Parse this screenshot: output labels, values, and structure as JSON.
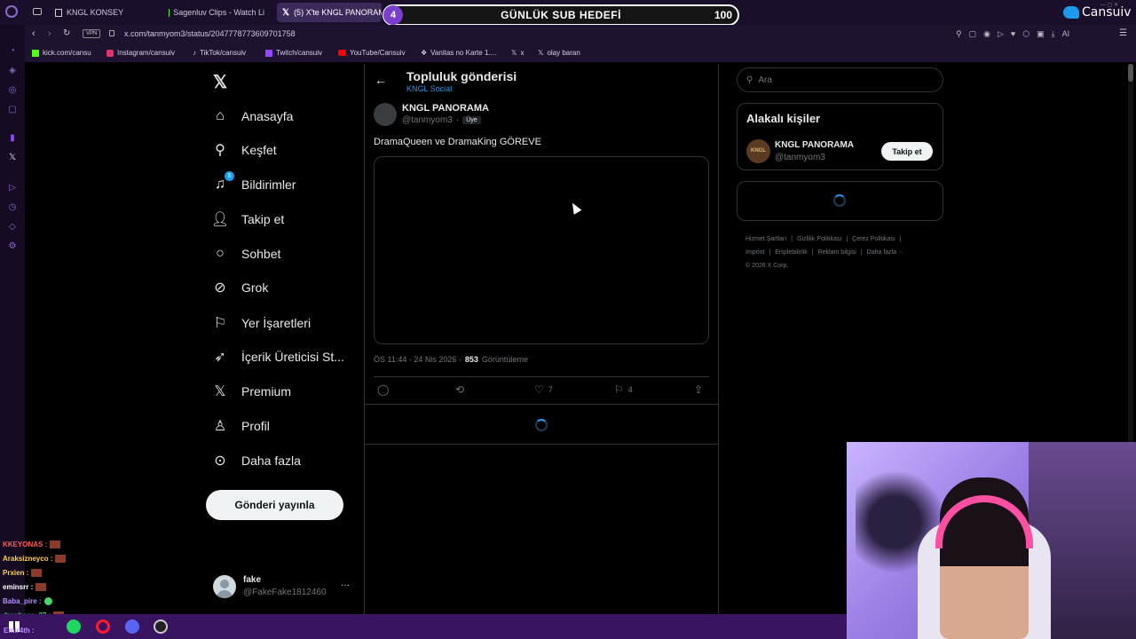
{
  "browser": {
    "tabs": [
      {
        "label": "KNGL KONSEY",
        "icon": "page-icon"
      },
      {
        "label": "Sagenluv Clips - Watch Li",
        "icon": "kick-icon"
      },
      {
        "label": "(5) X'te KNGL PANORAMA",
        "icon": "x-icon"
      }
    ],
    "vpn_label": "VPN",
    "url": "x.com/tanmyom3/status/2047778773609701758",
    "ai_label": "AI",
    "bookmarks": [
      {
        "label": "kick.com/cansu",
        "icon": "kick-icon"
      },
      {
        "label": "Instagram/cansuiv",
        "icon": "instagram-icon"
      },
      {
        "label": "TikTok/cansuiv",
        "icon": "tiktok-icon"
      },
      {
        "label": "Twitch/cansuiv",
        "icon": "twitch-icon"
      },
      {
        "label": "YouTube/Cansuiv",
        "icon": "youtube-icon"
      },
      {
        "label": "Vanitas no Karte 1....",
        "icon": "page-icon"
      },
      {
        "label": "x",
        "icon": "x-icon"
      },
      {
        "label": "olay baran",
        "icon": "x-icon"
      }
    ]
  },
  "overlay": {
    "sub_goal_count": "4",
    "sub_goal_title": "GÜNLÜK SUB HEDEFİ",
    "sub_goal_target": "100",
    "brand": "Cansuiv"
  },
  "nav": {
    "items": [
      {
        "label": "Anasayfa",
        "icon": "home-icon"
      },
      {
        "label": "Keşfet",
        "icon": "search-icon"
      },
      {
        "label": "Bildirimler",
        "icon": "bell-icon",
        "badge": "5"
      },
      {
        "label": "Takip et",
        "icon": "add-person-icon"
      },
      {
        "label": "Sohbet",
        "icon": "chat-icon"
      },
      {
        "label": "Grok",
        "icon": "grok-icon"
      },
      {
        "label": "Yer İşaretleri",
        "icon": "bookmark-icon"
      },
      {
        "label": "İçerik Üreticisi St...",
        "icon": "rocket-icon"
      },
      {
        "label": "Premium",
        "icon": "x-icon"
      },
      {
        "label": "Profil",
        "icon": "person-icon"
      },
      {
        "label": "Daha fazla",
        "icon": "more-circle-icon"
      }
    ],
    "post_button": "Gönderi yayınla",
    "account": {
      "name": "fake",
      "handle": "@FakeFake1812460"
    }
  },
  "post": {
    "header_title": "Topluluk gönderisi",
    "community": "KNGL Social",
    "author_name": "KNGL PANORAMA",
    "author_handle": "@tanmyom3",
    "member_badge": "Üye",
    "text": "DramaQueen ve DramaKing GÖREVE",
    "time": "ÖS 11:44 · 24 Nis 2026 ·",
    "views_count": "853",
    "views_label": "Görüntüleme",
    "likes": "7",
    "bookmarks": "4"
  },
  "sidebar": {
    "search_placeholder": "Ara",
    "related_title": "Alakalı kişiler",
    "related_name": "KNGL PANORAMA",
    "related_handle": "@tanmyom3",
    "follow_label": "Takip et",
    "footer": [
      "Hizmet Şartları",
      "Gizlilik Politikası",
      "Çerez Politikası",
      "Imprint",
      "Erişilebilirlik",
      "Reklam bilgisi",
      "Daha fazla ···",
      "© 2026 X Corp."
    ]
  },
  "chat": [
    {
      "user": "KKEYONAS :",
      "color": "#ff5a5a"
    },
    {
      "user": "Araksizneyco :",
      "color": "#ffd04a"
    },
    {
      "user": "Prxien :",
      "color": "#ffd04a"
    },
    {
      "user": "eminsrr :",
      "color": "#ffffff"
    },
    {
      "user": "Baba_pire :",
      "color": "#b98cff"
    },
    {
      "user": "drogbaaa_37 :",
      "color": "#4ad36a"
    },
    {
      "user": "Emir4th :",
      "color": "#b98cff"
    }
  ],
  "colors": {
    "accent": "#1d9bf0",
    "background": "#000000",
    "chrome": "#1a0f2b",
    "taskbar": "#3a1460"
  }
}
